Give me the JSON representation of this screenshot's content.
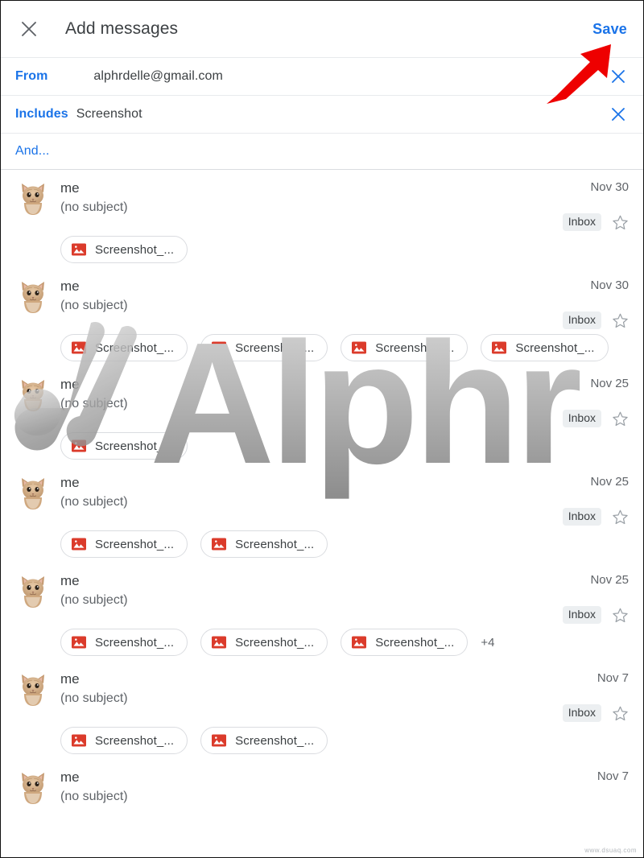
{
  "header": {
    "close_icon": "close-icon",
    "title": "Add messages",
    "save_label": "Save"
  },
  "criteria": [
    {
      "label": "From",
      "value": "alphrdelle@gmail.com",
      "remove_icon": "close-icon"
    },
    {
      "label": "Includes",
      "value": "Screenshot",
      "remove_icon": "close-icon"
    }
  ],
  "and_link": "And...",
  "messages": [
    {
      "avatar": "cat-avatar",
      "sender": "me",
      "subject": "(no subject)",
      "date": "Nov 30",
      "label": "Inbox",
      "star_icon": "star-outline-icon",
      "attachments": [
        "Screenshot_..."
      ],
      "more_count": ""
    },
    {
      "avatar": "cat-avatar",
      "sender": "me",
      "subject": "(no subject)",
      "date": "Nov 30",
      "label": "Inbox",
      "star_icon": "star-outline-icon",
      "attachments": [
        "Screenshot_...",
        "Screenshot_...",
        "Screenshot_...",
        "Screenshot_..."
      ],
      "more_count": ""
    },
    {
      "avatar": "cat-avatar",
      "sender": "me",
      "subject": "(no subject)",
      "date": "Nov 25",
      "label": "Inbox",
      "star_icon": "star-outline-icon",
      "attachments": [
        "Screenshot_..."
      ],
      "more_count": ""
    },
    {
      "avatar": "cat-avatar",
      "sender": "me",
      "subject": "(no subject)",
      "date": "Nov 25",
      "label": "Inbox",
      "star_icon": "star-outline-icon",
      "attachments": [
        "Screenshot_...",
        "Screenshot_..."
      ],
      "more_count": ""
    },
    {
      "avatar": "cat-avatar",
      "sender": "me",
      "subject": "(no subject)",
      "date": "Nov 25",
      "label": "Inbox",
      "star_icon": "star-outline-icon",
      "attachments": [
        "Screenshot_...",
        "Screenshot_...",
        "Screenshot_..."
      ],
      "more_count": "+4"
    },
    {
      "avatar": "cat-avatar",
      "sender": "me",
      "subject": "(no subject)",
      "date": "Nov 7",
      "label": "Inbox",
      "star_icon": "star-outline-icon",
      "attachments": [
        "Screenshot_...",
        "Screenshot_..."
      ],
      "more_count": ""
    },
    {
      "avatar": "cat-avatar",
      "sender": "me",
      "subject": "(no subject)",
      "date": "Nov 7",
      "label": "",
      "star_icon": "",
      "attachments": [],
      "more_count": ""
    }
  ],
  "annotation": {
    "arrow_icon": "red-arrow-icon",
    "arrow_color": "#ee0000"
  },
  "watermark": {
    "text": "Alphr",
    "logo_icon": "alphr-logo-icon"
  },
  "site_credit": "www.dsuaq.com",
  "colors": {
    "accent_blue": "#1a73e8",
    "text_primary": "#3c4043",
    "text_secondary": "#5f6368",
    "chip_border": "#dadce0",
    "label_bg": "#eceff1",
    "attachment_icon": "#db3b2b"
  }
}
